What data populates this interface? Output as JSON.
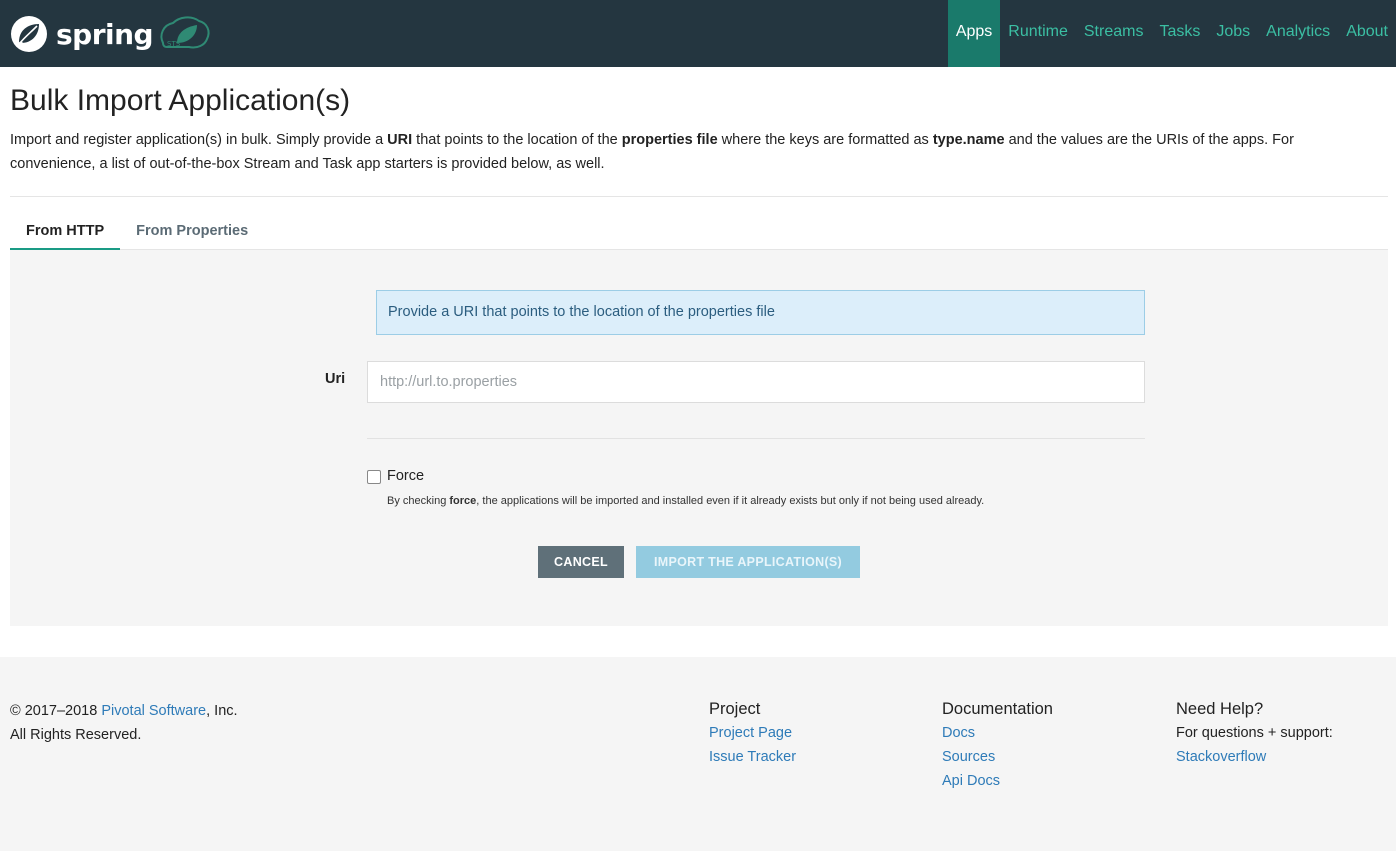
{
  "brand": {
    "name": "spring"
  },
  "nav": {
    "items": [
      {
        "label": "Apps",
        "active": true
      },
      {
        "label": "Runtime",
        "active": false
      },
      {
        "label": "Streams",
        "active": false
      },
      {
        "label": "Tasks",
        "active": false
      },
      {
        "label": "Jobs",
        "active": false
      },
      {
        "label": "Analytics",
        "active": false
      },
      {
        "label": "About",
        "active": false
      }
    ]
  },
  "page": {
    "title": "Bulk Import Application(s)",
    "desc_1": "Import and register application(s) in bulk. Simply provide a ",
    "desc_uri": "URI",
    "desc_2": " that points to the location of the ",
    "desc_props": "properties file",
    "desc_3": " where the keys are formatted as ",
    "desc_typename": "type.name",
    "desc_4": " and the values are the URIs of the apps. For convenience, a list of out-of-the-box Stream and Task app starters is provided below, as well."
  },
  "tabs": [
    {
      "label": "From HTTP",
      "active": true
    },
    {
      "label": "From Properties",
      "active": false
    }
  ],
  "form": {
    "info": "Provide a URI that points to the location of the properties file",
    "uri_label": "Uri",
    "uri_value": "",
    "uri_placeholder": "http://url.to.properties",
    "force_label": "Force",
    "force_checked": false,
    "force_help_1": "By checking ",
    "force_help_bold": "force",
    "force_help_2": ", the applications will be imported and installed even if it already exists but only if not being used already.",
    "cancel_label": "CANCEL",
    "import_label": "IMPORT THE APPLICATION(S)"
  },
  "footer": {
    "copy_prefix": "© 2017–2018 ",
    "copy_link": "Pivotal Software",
    "copy_suffix": ", Inc.",
    "rights": "All Rights Reserved.",
    "project": {
      "heading": "Project",
      "links": [
        "Project Page",
        "Issue Tracker"
      ]
    },
    "documentation": {
      "heading": "Documentation",
      "links": [
        "Docs",
        "Sources",
        "Api Docs"
      ]
    },
    "help": {
      "heading": "Need Help?",
      "text": "For questions + support:",
      "links": [
        "Stackoverflow"
      ]
    }
  },
  "colors": {
    "nav_bg": "#243640",
    "accent": "#3bbfa3",
    "nav_active_bg": "#1a7a6b",
    "link": "#2e7bb8"
  }
}
